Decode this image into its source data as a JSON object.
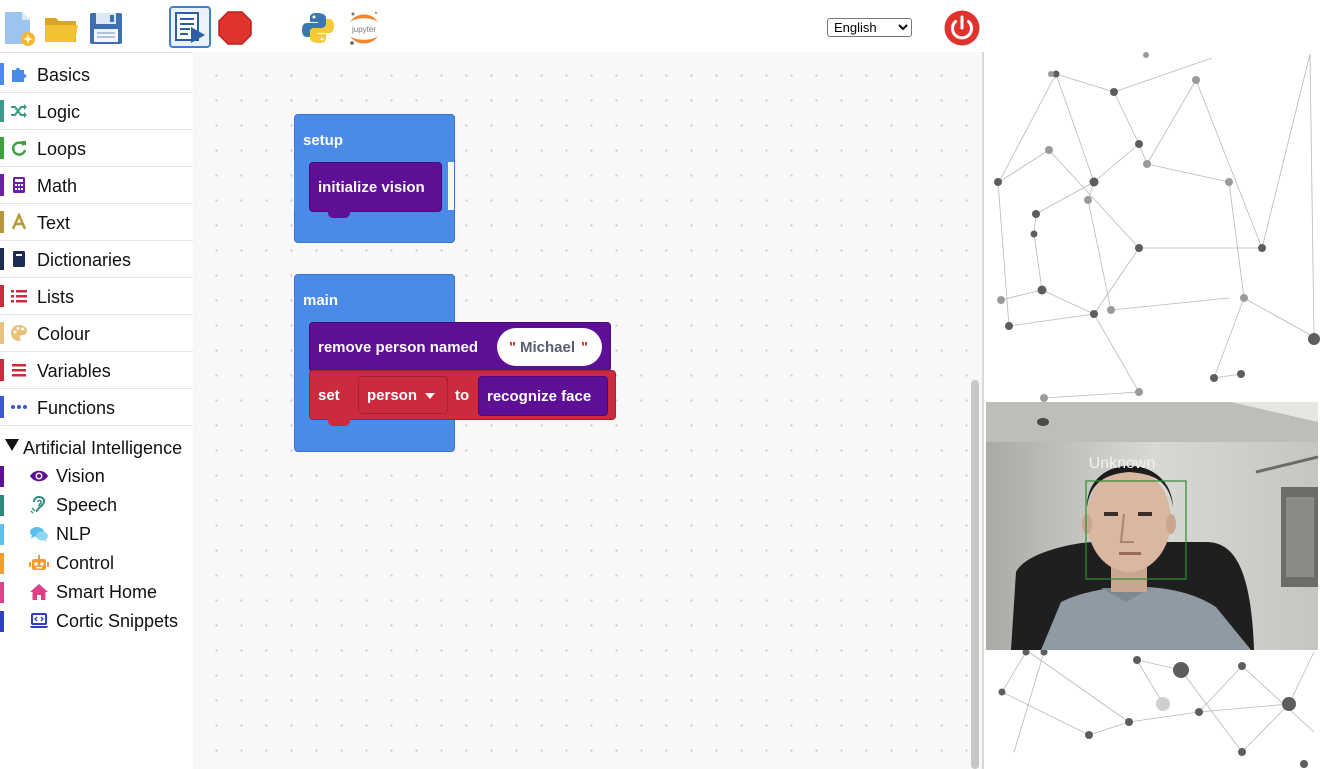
{
  "toolbar": {
    "language": "English",
    "icons": [
      "new-file-icon",
      "open-folder-icon",
      "save-icon",
      "run-code-icon",
      "stop-icon",
      "python-icon",
      "jupyter-icon",
      "power-icon"
    ],
    "jupyter_text": "jupyter"
  },
  "sidebar": {
    "categories": [
      {
        "label": "Basics",
        "color": "#4a8ae8",
        "icon": "puzzle-icon"
      },
      {
        "label": "Logic",
        "color": "#3d9a8a",
        "icon": "shuffle-icon"
      },
      {
        "label": "Loops",
        "color": "#3ba33b",
        "icon": "loop-icon"
      },
      {
        "label": "Math",
        "color": "#6a1fa8",
        "icon": "calculator-icon"
      },
      {
        "label": "Text",
        "color": "#b8963a",
        "icon": "font-icon"
      },
      {
        "label": "Dictionaries",
        "color": "#1e2b52",
        "icon": "book-icon"
      },
      {
        "label": "Lists",
        "color": "#cc2b3d",
        "icon": "list-icon"
      },
      {
        "label": "Colour",
        "color": "#e8c17a",
        "icon": "palette-icon"
      },
      {
        "label": "Variables",
        "color": "#cc2b3d",
        "icon": "bars-icon"
      },
      {
        "label": "Functions",
        "color": "#3a57d6",
        "icon": "dots-icon"
      }
    ],
    "ai_header": "Artificial Intelligence",
    "ai_items": [
      {
        "label": "Vision",
        "color": "#5d0f95",
        "icon": "eye-icon"
      },
      {
        "label": "Speech",
        "color": "#2e8b7f",
        "icon": "ear-icon"
      },
      {
        "label": "NLP",
        "color": "#5bc0eb",
        "icon": "chat-icon"
      },
      {
        "label": "Control",
        "color": "#f39c33",
        "icon": "robot-icon"
      },
      {
        "label": "Smart Home",
        "color": "#e0408a",
        "icon": "home-icon"
      },
      {
        "label": "Cortic Snippets",
        "color": "#2c3fc7",
        "icon": "laptop-code-icon"
      }
    ]
  },
  "workspace": {
    "setup_label": "setup",
    "init_vision": "initialize vision",
    "main_label": "main",
    "remove_person": "remove person named",
    "name_open_quote": "\"",
    "name_value": "Michael",
    "name_close_quote": "\"",
    "set_label": "set",
    "var_name": "person",
    "to_label": "to",
    "recognize_face": "recognize face"
  },
  "camera": {
    "face_label": "Unknown"
  }
}
